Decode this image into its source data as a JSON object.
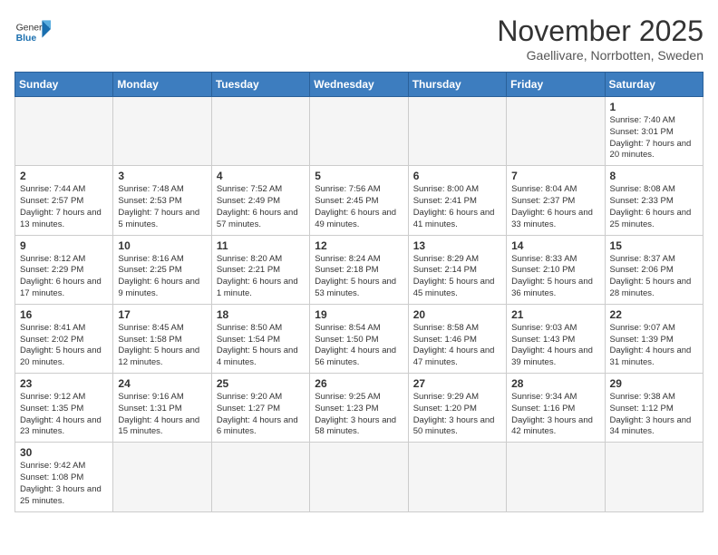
{
  "header": {
    "logo_general": "General",
    "logo_blue": "Blue",
    "month_title": "November 2025",
    "subtitle": "Gaellivare, Norrbotten, Sweden"
  },
  "weekdays": [
    "Sunday",
    "Monday",
    "Tuesday",
    "Wednesday",
    "Thursday",
    "Friday",
    "Saturday"
  ],
  "weeks": [
    [
      {
        "day": "",
        "info": ""
      },
      {
        "day": "",
        "info": ""
      },
      {
        "day": "",
        "info": ""
      },
      {
        "day": "",
        "info": ""
      },
      {
        "day": "",
        "info": ""
      },
      {
        "day": "",
        "info": ""
      },
      {
        "day": "1",
        "info": "Sunrise: 7:40 AM\nSunset: 3:01 PM\nDaylight: 7 hours and 20 minutes."
      }
    ],
    [
      {
        "day": "2",
        "info": "Sunrise: 7:44 AM\nSunset: 2:57 PM\nDaylight: 7 hours and 13 minutes."
      },
      {
        "day": "3",
        "info": "Sunrise: 7:48 AM\nSunset: 2:53 PM\nDaylight: 7 hours and 5 minutes."
      },
      {
        "day": "4",
        "info": "Sunrise: 7:52 AM\nSunset: 2:49 PM\nDaylight: 6 hours and 57 minutes."
      },
      {
        "day": "5",
        "info": "Sunrise: 7:56 AM\nSunset: 2:45 PM\nDaylight: 6 hours and 49 minutes."
      },
      {
        "day": "6",
        "info": "Sunrise: 8:00 AM\nSunset: 2:41 PM\nDaylight: 6 hours and 41 minutes."
      },
      {
        "day": "7",
        "info": "Sunrise: 8:04 AM\nSunset: 2:37 PM\nDaylight: 6 hours and 33 minutes."
      },
      {
        "day": "8",
        "info": "Sunrise: 8:08 AM\nSunset: 2:33 PM\nDaylight: 6 hours and 25 minutes."
      }
    ],
    [
      {
        "day": "9",
        "info": "Sunrise: 8:12 AM\nSunset: 2:29 PM\nDaylight: 6 hours and 17 minutes."
      },
      {
        "day": "10",
        "info": "Sunrise: 8:16 AM\nSunset: 2:25 PM\nDaylight: 6 hours and 9 minutes."
      },
      {
        "day": "11",
        "info": "Sunrise: 8:20 AM\nSunset: 2:21 PM\nDaylight: 6 hours and 1 minute."
      },
      {
        "day": "12",
        "info": "Sunrise: 8:24 AM\nSunset: 2:18 PM\nDaylight: 5 hours and 53 minutes."
      },
      {
        "day": "13",
        "info": "Sunrise: 8:29 AM\nSunset: 2:14 PM\nDaylight: 5 hours and 45 minutes."
      },
      {
        "day": "14",
        "info": "Sunrise: 8:33 AM\nSunset: 2:10 PM\nDaylight: 5 hours and 36 minutes."
      },
      {
        "day": "15",
        "info": "Sunrise: 8:37 AM\nSunset: 2:06 PM\nDaylight: 5 hours and 28 minutes."
      }
    ],
    [
      {
        "day": "16",
        "info": "Sunrise: 8:41 AM\nSunset: 2:02 PM\nDaylight: 5 hours and 20 minutes."
      },
      {
        "day": "17",
        "info": "Sunrise: 8:45 AM\nSunset: 1:58 PM\nDaylight: 5 hours and 12 minutes."
      },
      {
        "day": "18",
        "info": "Sunrise: 8:50 AM\nSunset: 1:54 PM\nDaylight: 5 hours and 4 minutes."
      },
      {
        "day": "19",
        "info": "Sunrise: 8:54 AM\nSunset: 1:50 PM\nDaylight: 4 hours and 56 minutes."
      },
      {
        "day": "20",
        "info": "Sunrise: 8:58 AM\nSunset: 1:46 PM\nDaylight: 4 hours and 47 minutes."
      },
      {
        "day": "21",
        "info": "Sunrise: 9:03 AM\nSunset: 1:43 PM\nDaylight: 4 hours and 39 minutes."
      },
      {
        "day": "22",
        "info": "Sunrise: 9:07 AM\nSunset: 1:39 PM\nDaylight: 4 hours and 31 minutes."
      }
    ],
    [
      {
        "day": "23",
        "info": "Sunrise: 9:12 AM\nSunset: 1:35 PM\nDaylight: 4 hours and 23 minutes."
      },
      {
        "day": "24",
        "info": "Sunrise: 9:16 AM\nSunset: 1:31 PM\nDaylight: 4 hours and 15 minutes."
      },
      {
        "day": "25",
        "info": "Sunrise: 9:20 AM\nSunset: 1:27 PM\nDaylight: 4 hours and 6 minutes."
      },
      {
        "day": "26",
        "info": "Sunrise: 9:25 AM\nSunset: 1:23 PM\nDaylight: 3 hours and 58 minutes."
      },
      {
        "day": "27",
        "info": "Sunrise: 9:29 AM\nSunset: 1:20 PM\nDaylight: 3 hours and 50 minutes."
      },
      {
        "day": "28",
        "info": "Sunrise: 9:34 AM\nSunset: 1:16 PM\nDaylight: 3 hours and 42 minutes."
      },
      {
        "day": "29",
        "info": "Sunrise: 9:38 AM\nSunset: 1:12 PM\nDaylight: 3 hours and 34 minutes."
      }
    ],
    [
      {
        "day": "30",
        "info": "Sunrise: 9:42 AM\nSunset: 1:08 PM\nDaylight: 3 hours and 25 minutes."
      },
      {
        "day": "",
        "info": ""
      },
      {
        "day": "",
        "info": ""
      },
      {
        "day": "",
        "info": ""
      },
      {
        "day": "",
        "info": ""
      },
      {
        "day": "",
        "info": ""
      },
      {
        "day": "",
        "info": ""
      }
    ]
  ]
}
